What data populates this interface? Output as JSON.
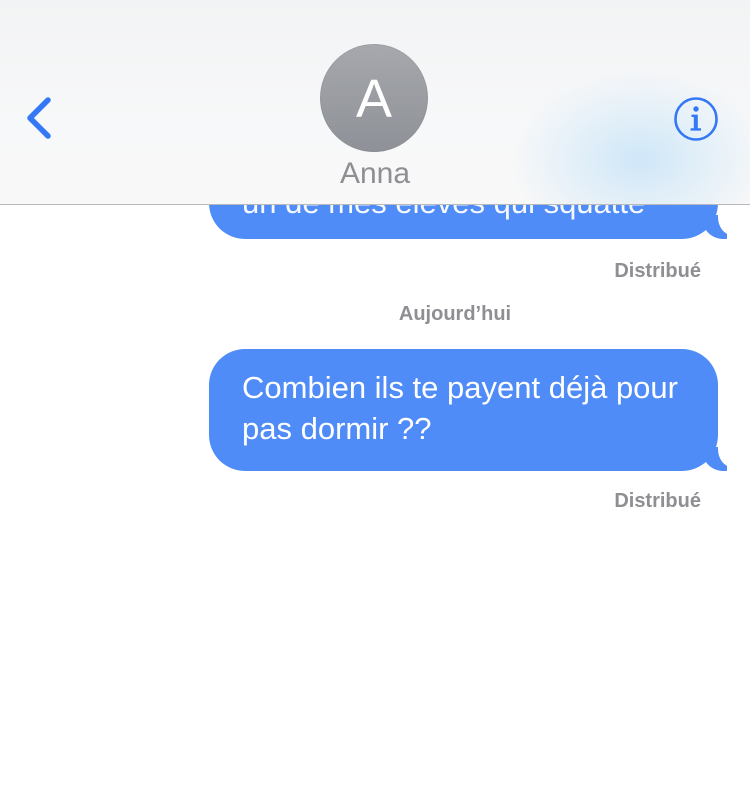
{
  "header": {
    "contact_initial": "A",
    "contact_name": "Anna",
    "back_icon": "chevron-left-icon",
    "info_icon": "info-circle-icon"
  },
  "messages": [
    {
      "text": "un de mes élèves qui squatte",
      "status": "Distribué"
    },
    {
      "text": "Combien ils te payent déjà pour pas dormir ??",
      "status": "Distribué"
    }
  ],
  "date_separator": "Aujourd’hui",
  "colors": {
    "accent": "#3478f6",
    "bubble": "#4f8cf7",
    "avatar": "#9a9ca1",
    "secondary_text": "#8e8e93"
  }
}
